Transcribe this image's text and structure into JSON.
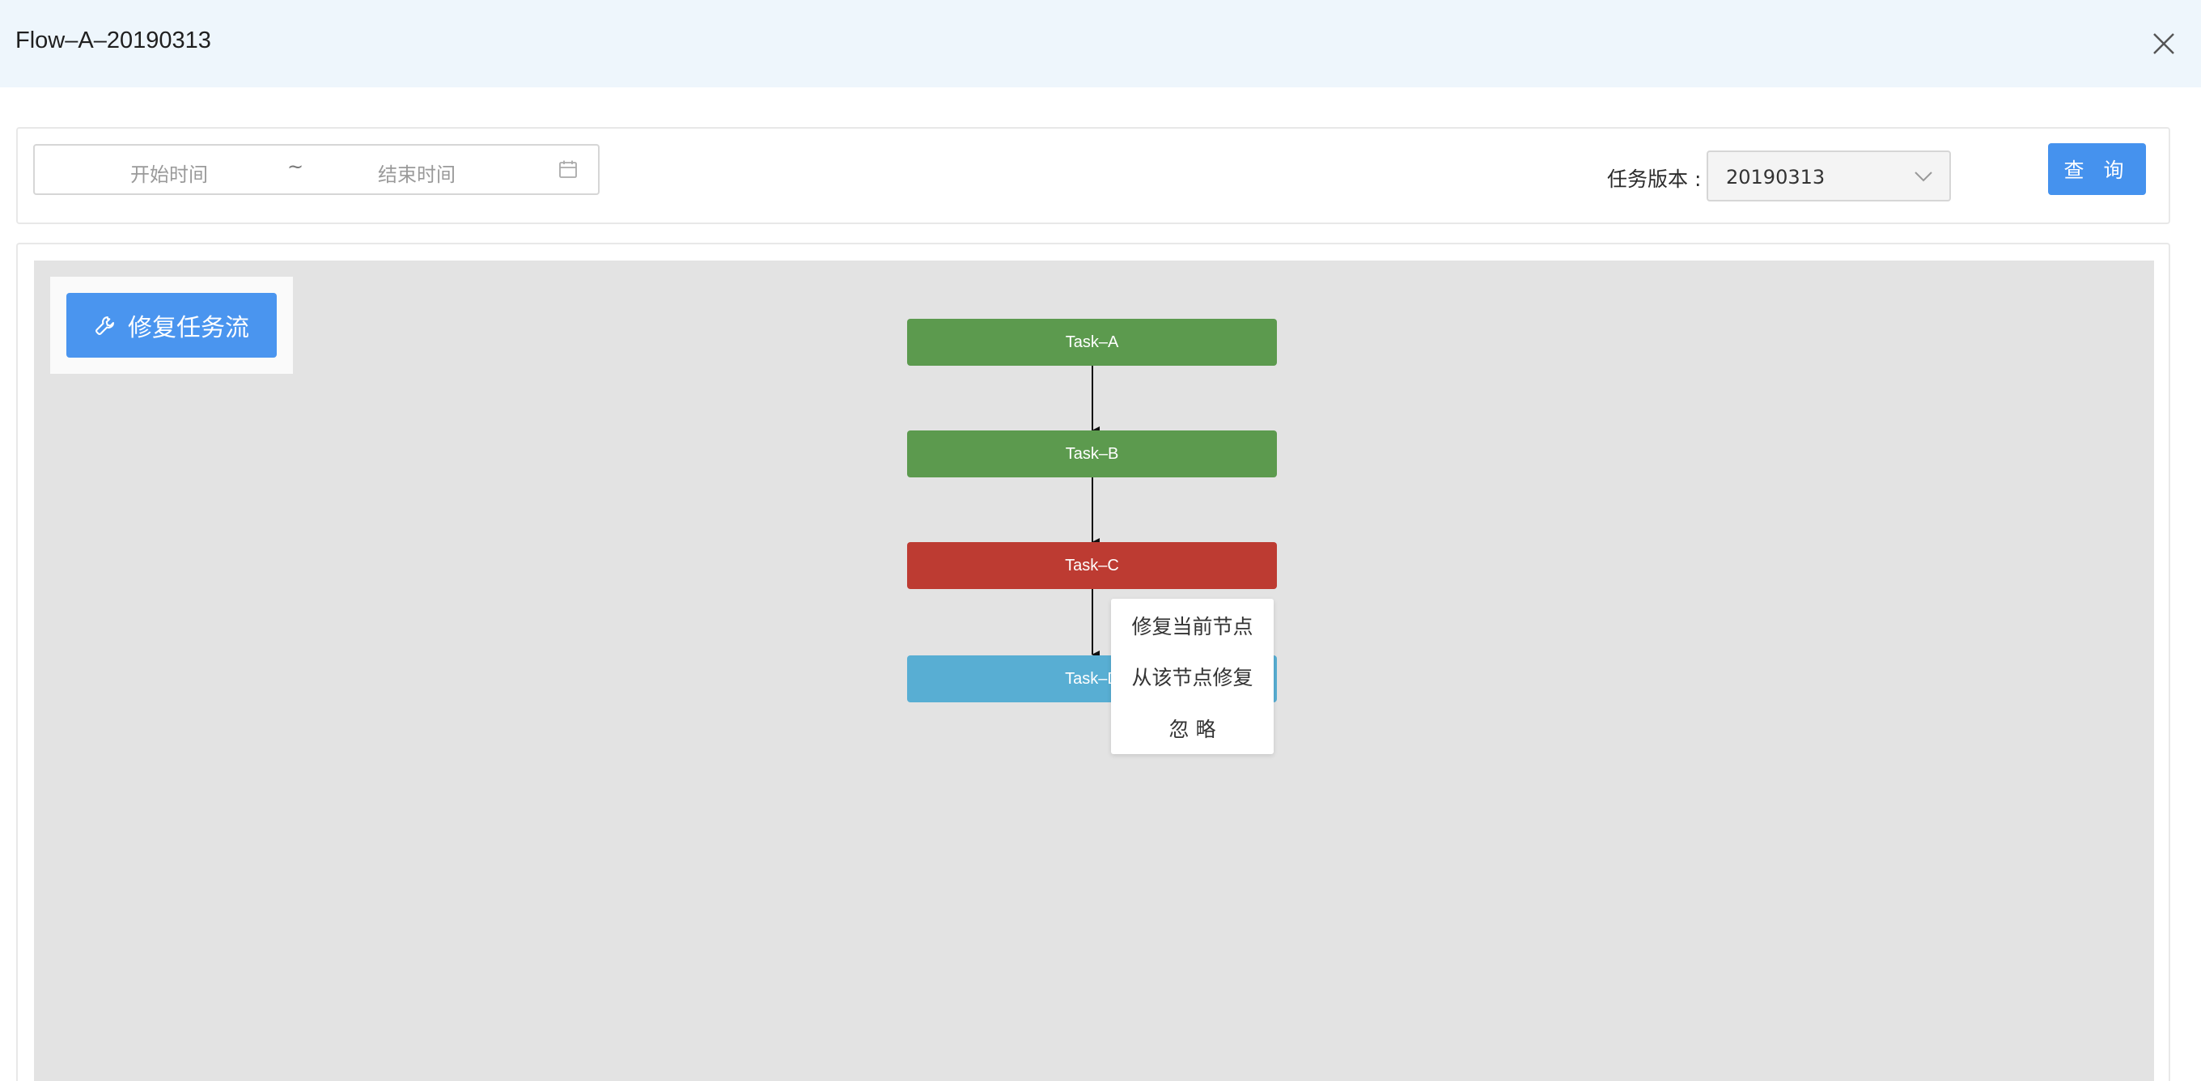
{
  "window": {
    "title": "Flow–A–20190313"
  },
  "filter": {
    "start_placeholder": "开始时间",
    "separator": "~",
    "end_placeholder": "结束时间",
    "version_label": "任务版本 :",
    "version_value": "20190313",
    "query_label": "查 询"
  },
  "toolbar": {
    "repair_flow_label": "修复任务流"
  },
  "graph": {
    "nodes": [
      {
        "label": "Task–A",
        "status": "success",
        "color": "#5c9a4e"
      },
      {
        "label": "Task–B",
        "status": "success",
        "color": "#5c9a4e"
      },
      {
        "label": "Task–C",
        "status": "failed",
        "color": "#bd3b32"
      },
      {
        "label": "Task–D",
        "status": "pending",
        "color": "#58aed3"
      }
    ],
    "edges": [
      [
        "Task–A",
        "Task–B"
      ],
      [
        "Task–B",
        "Task–C"
      ],
      [
        "Task–C",
        "Task–D"
      ]
    ]
  },
  "context_menu": {
    "items": [
      "修复当前节点",
      "从该节点修复",
      "忽 略"
    ]
  },
  "colors": {
    "accent": "#4592ee",
    "header_bg": "#eef6fc",
    "canvas_bg": "#e3e3e3"
  }
}
